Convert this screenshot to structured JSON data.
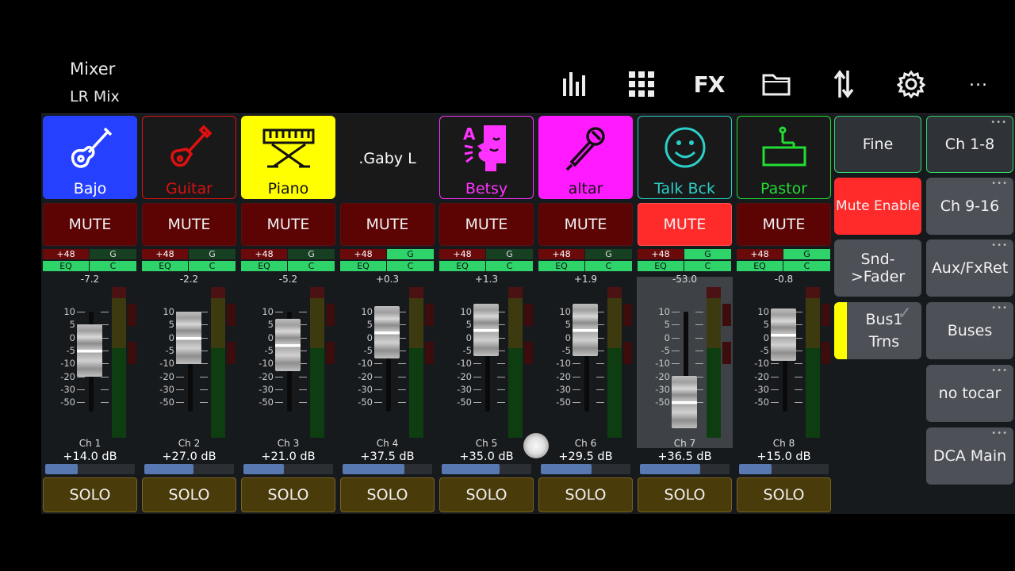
{
  "header": {
    "title": "Mixer",
    "subtitle": "LR Mix",
    "icons": [
      "meters-icon",
      "grid-icon",
      "fx",
      "folder-icon",
      "routing-icon",
      "gear-icon",
      "more"
    ],
    "fx_label": "FX",
    "more_label": "..."
  },
  "channels": [
    {
      "name": "Bajo",
      "icon": "bass-guitar-icon",
      "name_color": "#ffffff",
      "bg": "#2540ff",
      "border": "#2540ff",
      "mute": "MUTE",
      "muted": false,
      "p48": "+48",
      "g": "G",
      "g_on": false,
      "eq": "EQ",
      "c": "C",
      "pan": "-7.2",
      "fader_db": -5,
      "ch": "Ch 1",
      "gain": "+14.0 dB",
      "gain_level": 0.36,
      "solo": "SOLO"
    },
    {
      "name": "Guitar",
      "icon": "electric-guitar-icon",
      "name_color": "#e01010",
      "bg": "#191919",
      "border": "#e01010",
      "mute": "MUTE",
      "muted": false,
      "p48": "+48",
      "g": "G",
      "g_on": false,
      "eq": "EQ",
      "c": "C",
      "pan": "-2.2",
      "fader_db": 0,
      "ch": "Ch 2",
      "gain": "+27.0 dB",
      "gain_level": 0.55,
      "solo": "SOLO"
    },
    {
      "name": "Piano",
      "icon": "keyboard-icon",
      "name_color": "#111111",
      "bg": "#ffff00",
      "border": "#ffff00",
      "mute": "MUTE",
      "muted": false,
      "p48": "+48",
      "g": "G",
      "g_on": false,
      "eq": "EQ",
      "c": "C",
      "pan": "-5.2",
      "fader_db": -3,
      "ch": "Ch 3",
      "gain": "+21.0 dB",
      "gain_level": 0.45,
      "solo": "SOLO"
    },
    {
      "name": ".Gaby L",
      "icon": "",
      "name_color": "#ffffff",
      "bg": "#191919",
      "border": "#191919",
      "mute": "MUTE",
      "muted": false,
      "p48": "+48",
      "g": "G",
      "g_on": true,
      "eq": "EQ",
      "c": "C",
      "pan": "+0.3",
      "fader_db": 2,
      "ch": "Ch 4",
      "gain": "+37.5 dB",
      "gain_level": 0.69,
      "solo": "SOLO"
    },
    {
      "name": "Betsy",
      "icon": "talking-head-icon",
      "name_color": "#ff33ff",
      "bg": "#191919",
      "border": "#ff33ff",
      "mute": "MUTE",
      "muted": false,
      "p48": "+48",
      "g": "G",
      "g_on": false,
      "eq": "EQ",
      "c": "C",
      "pan": "+1.3",
      "fader_db": 3,
      "ch": "Ch 5",
      "gain": "+35.0 dB",
      "gain_level": 0.65,
      "solo": "SOLO"
    },
    {
      "name": "altar",
      "icon": "microphone-icon",
      "name_color": "#111111",
      "bg": "#ff1aff",
      "border": "#ff1aff",
      "mute": "MUTE",
      "muted": false,
      "p48": "+48",
      "g": "G",
      "g_on": false,
      "eq": "EQ",
      "c": "C",
      "pan": "+1.9",
      "fader_db": 3,
      "ch": "Ch 6",
      "gain": "+29.5 dB",
      "gain_level": 0.57,
      "solo": "SOLO"
    },
    {
      "name": "Talk Bck",
      "icon": "smiley-icon",
      "name_color": "#2ad0c8",
      "bg": "#191919",
      "border": "#2ad0c8",
      "mute": "MUTE",
      "muted": true,
      "p48": "+48",
      "g": "G",
      "g_on": true,
      "eq": "EQ",
      "c": "C",
      "pan": "-53.0",
      "fader_db": -50,
      "ch": "Ch 7",
      "gain": "+36.5 dB",
      "gain_level": 0.67,
      "solo": "SOLO",
      "selected": true
    },
    {
      "name": "Pastor",
      "icon": "podium-icon",
      "name_color": "#22dd33",
      "bg": "#191919",
      "border": "#22dd33",
      "mute": "MUTE",
      "muted": false,
      "p48": "+48",
      "g": "G",
      "g_on": true,
      "eq": "EQ",
      "c": "C",
      "pan": "-0.8",
      "fader_db": 1,
      "ch": "Ch 8",
      "gain": "+15.0 dB",
      "gain_level": 0.36,
      "solo": "SOLO"
    }
  ],
  "fader_scale": [
    "10",
    "5",
    "0",
    "-5",
    "-10",
    "-20",
    "-30",
    "-50"
  ],
  "right_panel": {
    "fine": "Fine",
    "mute_enable": "Mute Enable",
    "snd_fader": "Snd->Fader",
    "bus1_line1": "Bus1",
    "bus1_line2": "Trns",
    "banks": [
      "Ch 1-8",
      "Ch 9-16",
      "Aux/FxRet",
      "Buses",
      "no tocar",
      "DCA Main"
    ],
    "more_dots": "•••"
  }
}
